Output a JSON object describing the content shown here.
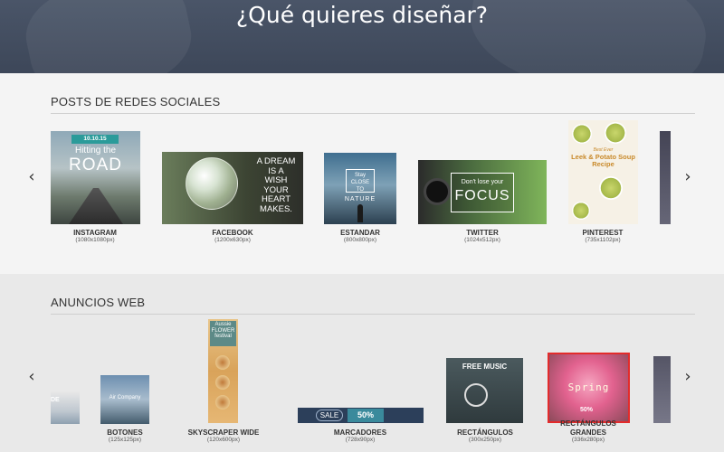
{
  "hero": {
    "title": "¿Qué quieres diseñar?"
  },
  "sections": {
    "social": {
      "heading": "POSTS DE REDES SOCIALES",
      "items": [
        {
          "name": "INSTAGRAM",
          "dims": "(1080x1080px)",
          "thumb_date": "10.10.15",
          "thumb_line1": "Hitting the",
          "thumb_line2": "ROAD"
        },
        {
          "name": "FACEBOOK",
          "dims": "(1200x630px)",
          "thumb_text": "A DREAM IS A WISH YOUR HEART MAKES."
        },
        {
          "name": "ESTANDAR",
          "dims": "(800x800px)",
          "thumb_box": "Stay CLOSE TO",
          "thumb_text": "NATURE"
        },
        {
          "name": "TWITTER",
          "dims": "(1024x512px)",
          "thumb_small": "Don't lose your",
          "thumb_big": "FOCUS"
        },
        {
          "name": "PINTEREST",
          "dims": "(735x1102px)",
          "thumb_small": "Best Ever",
          "thumb_big": "Leek & Potato Soup Recipe"
        }
      ]
    },
    "ads": {
      "heading": "ANUNCIOS WEB",
      "items": [
        {
          "name": "BOTONES",
          "dims": "(125x125px)",
          "thumb_partial": "DE",
          "thumb_text": "Air Company"
        },
        {
          "name": "SKYSCRAPER WIDE",
          "dims": "(120x600px)",
          "thumb_text": "Aussie FLOWER festival"
        },
        {
          "name": "MARCADORES",
          "dims": "(728x90px)",
          "thumb_sale": "SALE",
          "thumb_pct": "50%"
        },
        {
          "name": "RECTÁNGULOS",
          "dims": "(300x250px)",
          "thumb_text": "FREE MUSIC"
        },
        {
          "name": "RECTÁNGULOS GRANDES",
          "dims": "(336x280px)",
          "thumb_text": "Spring",
          "thumb_pct": "50%"
        }
      ]
    }
  },
  "nav": {
    "prev": "‹",
    "next": "›"
  },
  "colors": {
    "hero_bg": "#3d4759",
    "accent_teal": "#2b9b9a",
    "highlight_border": "#e32b2b"
  }
}
